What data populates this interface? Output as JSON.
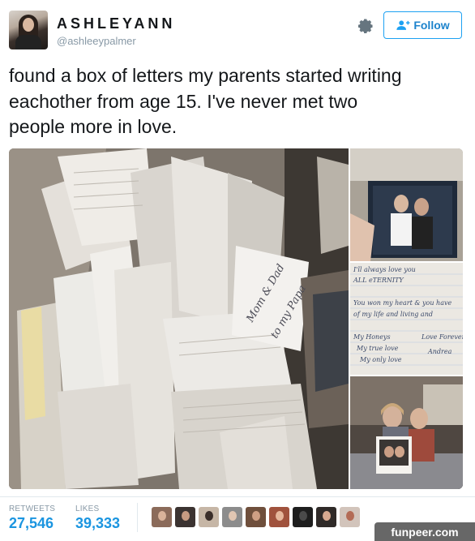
{
  "header": {
    "display_name": "ASHLEYANN",
    "handle": "@ashleeypalmer",
    "follow_label": "Follow",
    "gear_icon": "gear-icon",
    "follow_icon": "add-user-icon"
  },
  "tweet": {
    "text_lines": [
      "found a box of letters my parents started writing",
      "eachother from age 15. I've never met two",
      "people more in love."
    ]
  },
  "media": {
    "photo_count": 4,
    "letter_fragments": [
      "Mom & Dad",
      "to my Papa"
    ],
    "note_lines": [
      "I'll always love you",
      "ALL eTERNITY",
      "You won my heart & you have",
      "of my life and living and",
      "My Honeys",
      "My true love",
      "My only love",
      "Love Forever",
      "Andrea"
    ]
  },
  "stats": {
    "retweets_label": "RETWEETS",
    "retweets_value": "27,546",
    "likes_label": "LIKES",
    "likes_value": "39,333"
  },
  "likers": [
    {
      "bg": "#8b6b5a",
      "face": "#d9b39a"
    },
    {
      "bg": "#3b3331",
      "face": "#c79b82"
    },
    {
      "bg": "#c6b6a6",
      "face": "#3a2e2a"
    },
    {
      "bg": "#8c8c8c",
      "face": "#e1c6b2"
    },
    {
      "bg": "#6f4f3c",
      "face": "#cf9f84"
    },
    {
      "bg": "#a0523d",
      "face": "#e6b79c"
    },
    {
      "bg": "#1e1e1e",
      "face": "#4a4a4a"
    },
    {
      "bg": "#2f2a28",
      "face": "#d8a990"
    },
    {
      "bg": "#d2c4bb",
      "face": "#b36b55"
    }
  ],
  "watermark": "funpeer.com",
  "colors": {
    "accent": "#1da1f2",
    "stat_value": "#1b95e0",
    "secondary_text": "#8899a6"
  }
}
